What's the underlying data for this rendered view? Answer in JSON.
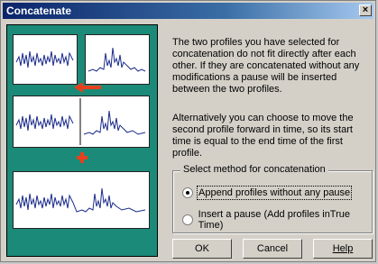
{
  "dialog": {
    "title": "Concatenate",
    "close_glyph": "×",
    "paragraph1": "The two profiles you have selected for concatenation do not fit directly after each other. If they are concatenated without any modifications a pause will be inserted between the two profiles.",
    "paragraph2": "Alternatively you can choose to move the second profile forward in time, so its start time is equal to the end time of the first profile.",
    "group_label": "Select method for concatenation",
    "options": [
      {
        "label": "Append profiles without any pause",
        "selected": true
      },
      {
        "label": "Insert a pause (Add profiles inTrue Time)",
        "selected": false
      }
    ],
    "buttons": {
      "ok": "OK",
      "cancel": "Cancel",
      "help": "Help"
    }
  },
  "colors": {
    "illustration_bg": "#1c8a78",
    "arrow": "#e8401c",
    "trace": "#1a2a8a"
  },
  "icons": {
    "arrow": "arrow-left-icon",
    "plus": "plus-icon"
  }
}
